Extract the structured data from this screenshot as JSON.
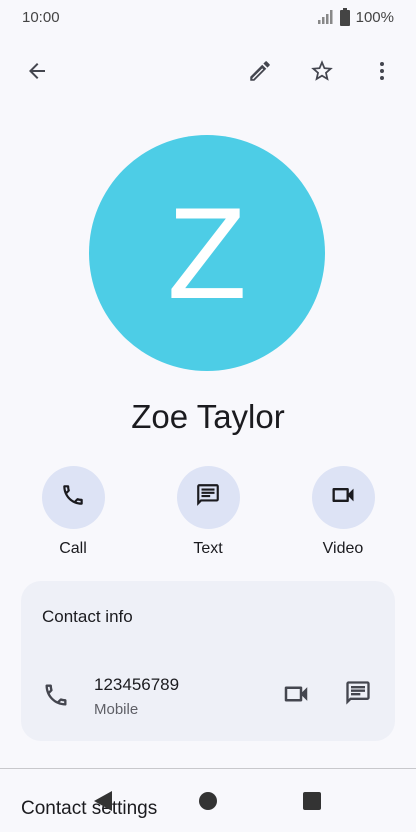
{
  "status_bar": {
    "time": "10:00",
    "battery": "100%",
    "icons": [
      "signal-icon",
      "battery-icon"
    ]
  },
  "app_bar": {
    "icons": [
      "back-arrow-icon",
      "edit-pencil-icon",
      "star-icon",
      "more-vert-icon"
    ]
  },
  "contact": {
    "initial": "Z",
    "name": "Zoe Taylor",
    "avatar_color": "#4dcde6"
  },
  "actions": [
    {
      "label": "Call",
      "icon": "phone-icon"
    },
    {
      "label": "Text",
      "icon": "message-icon"
    },
    {
      "label": "Video",
      "icon": "video-icon"
    }
  ],
  "contact_info": {
    "title": "Contact info",
    "phone": {
      "number": "123456789",
      "type": "Mobile"
    }
  },
  "settings": {
    "label": "Contact settings"
  },
  "nav_bar": {
    "icons": [
      "nav-back-icon",
      "nav-home-icon",
      "nav-recents-icon"
    ]
  }
}
